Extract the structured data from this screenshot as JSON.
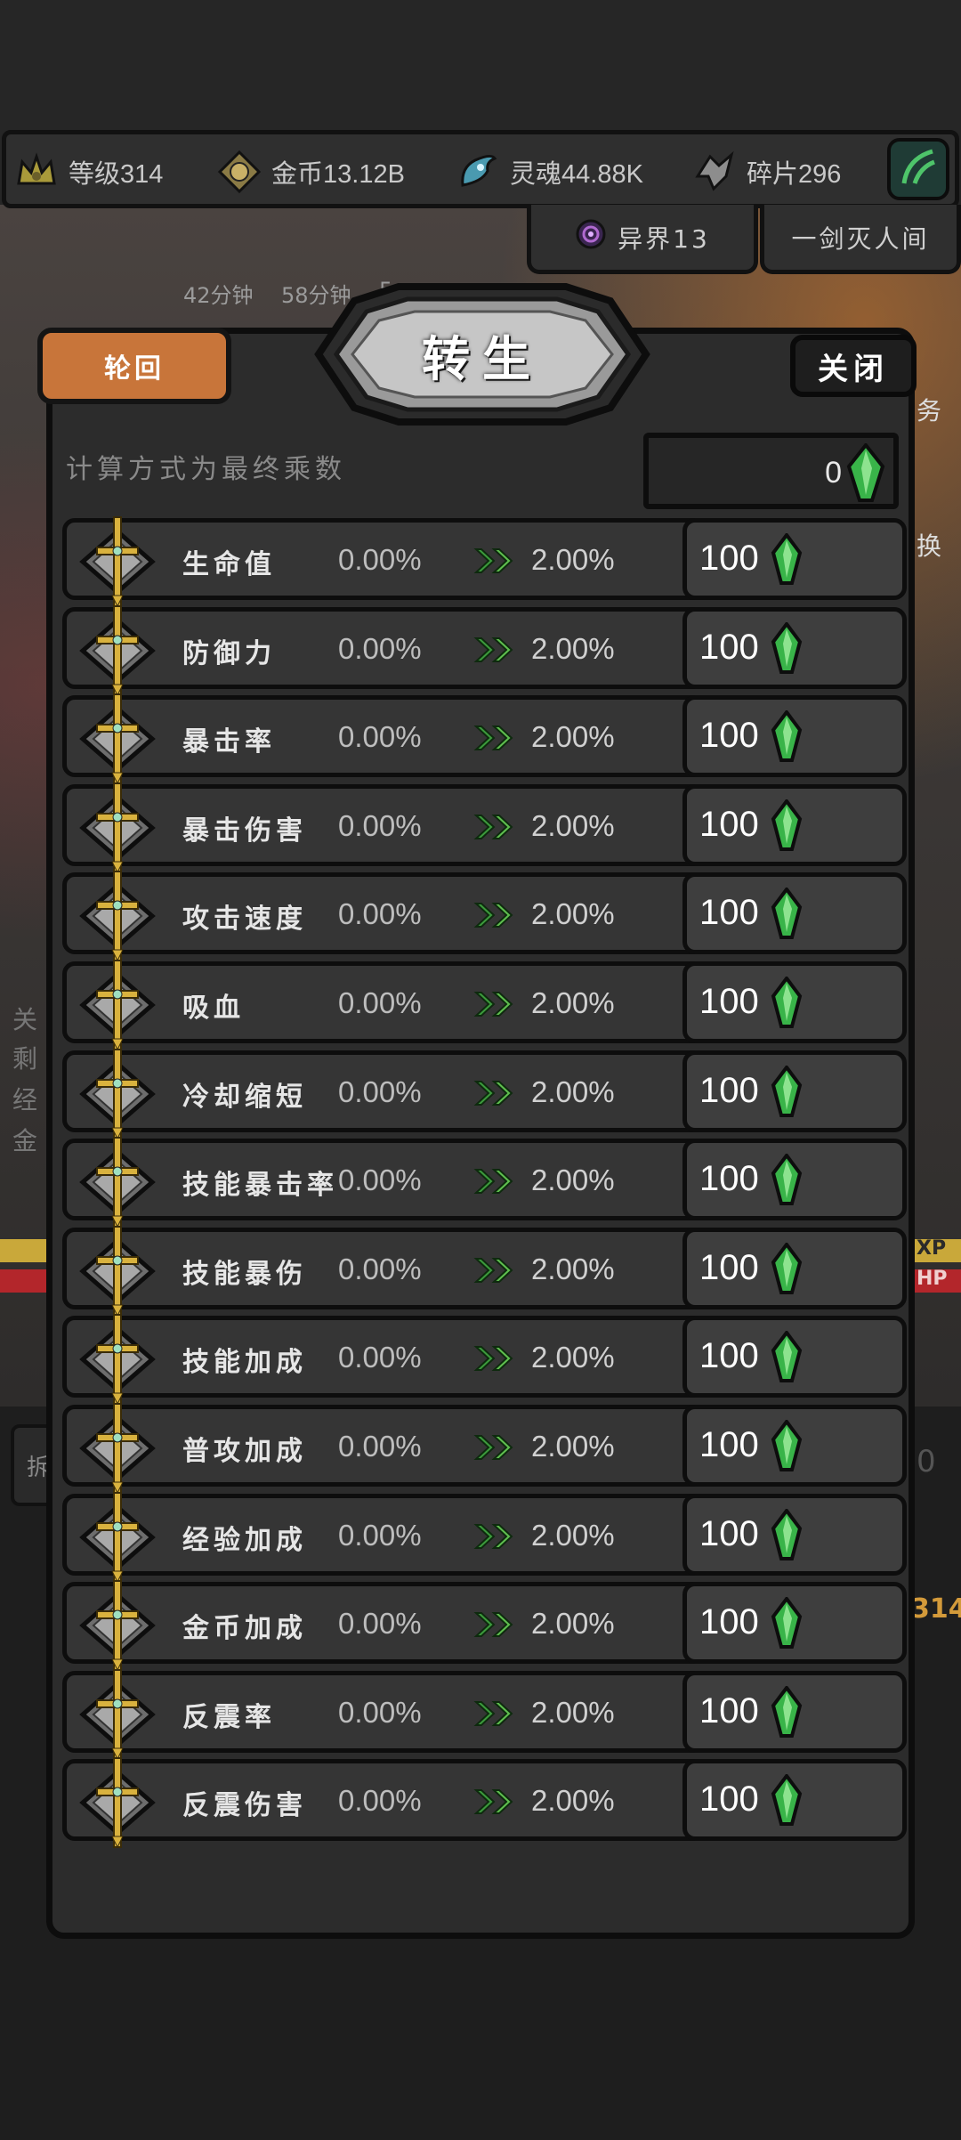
{
  "resources": [
    {
      "label": "等级",
      "value": "314",
      "icon": "crown-icon"
    },
    {
      "label": "金币",
      "value": "13.12B",
      "icon": "gold-coin-icon"
    },
    {
      "label": "灵魂",
      "value": "44.88K",
      "icon": "soul-icon"
    },
    {
      "label": "碎片",
      "value": "296",
      "icon": "fragment-icon"
    }
  ],
  "tags": {
    "otherworld": "异界13",
    "quest": "一剑灭人间"
  },
  "background_text": {
    "timer1": "42分钟",
    "timer2": "58分钟",
    "timer3": "5",
    "side_right": "务",
    "side_right2": "换",
    "xp": "XP",
    "hp": "HP",
    "partial_num": "0",
    "level_badge": "314",
    "left_chars": [
      "关",
      "剩",
      "经",
      "金"
    ],
    "left_btn": "拆"
  },
  "dialog": {
    "tab_label": "轮回",
    "title": "转生",
    "close_label": "关闭",
    "calc_label": "计算方式为最终乘数",
    "total_value": "0"
  },
  "stats": [
    {
      "name": "生命值",
      "current": "0.00%",
      "next": "2.00%",
      "cost": "100"
    },
    {
      "name": "防御力",
      "current": "0.00%",
      "next": "2.00%",
      "cost": "100"
    },
    {
      "name": "暴击率",
      "current": "0.00%",
      "next": "2.00%",
      "cost": "100"
    },
    {
      "name": "暴击伤害",
      "current": "0.00%",
      "next": "2.00%",
      "cost": "100"
    },
    {
      "name": "攻击速度",
      "current": "0.00%",
      "next": "2.00%",
      "cost": "100"
    },
    {
      "name": "吸血",
      "current": "0.00%",
      "next": "2.00%",
      "cost": "100"
    },
    {
      "name": "冷却缩短",
      "current": "0.00%",
      "next": "2.00%",
      "cost": "100"
    },
    {
      "name": "技能暴击率",
      "current": "0.00%",
      "next": "2.00%",
      "cost": "100"
    },
    {
      "name": "技能暴伤",
      "current": "0.00%",
      "next": "2.00%",
      "cost": "100"
    },
    {
      "name": "技能加成",
      "current": "0.00%",
      "next": "2.00%",
      "cost": "100"
    },
    {
      "name": "普攻加成",
      "current": "0.00%",
      "next": "2.00%",
      "cost": "100"
    },
    {
      "name": "经验加成",
      "current": "0.00%",
      "next": "2.00%",
      "cost": "100"
    },
    {
      "name": "金币加成",
      "current": "0.00%",
      "next": "2.00%",
      "cost": "100"
    },
    {
      "name": "反震率",
      "current": "0.00%",
      "next": "2.00%",
      "cost": "100"
    },
    {
      "name": "反震伤害",
      "current": "0.00%",
      "next": "2.00%",
      "cost": "100"
    }
  ],
  "colors": {
    "accent_orange": "#c8753a",
    "gem_green": "#3fbf4a",
    "arrow_green": "#3c9a3c",
    "panel": "#2c2c2c"
  }
}
